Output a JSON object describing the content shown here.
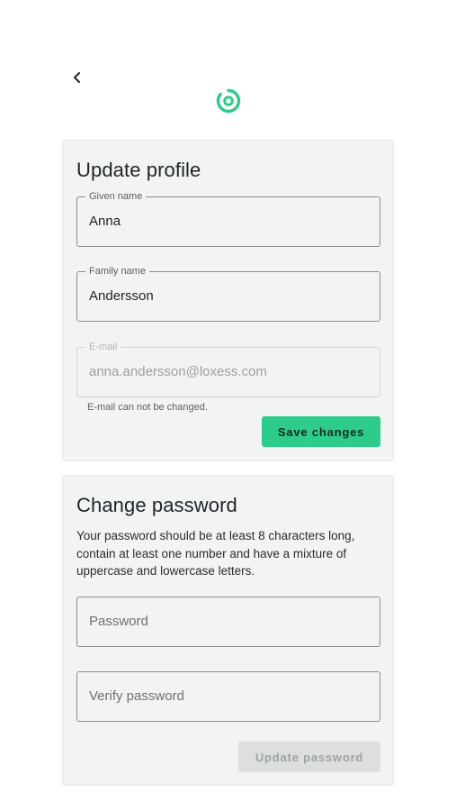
{
  "colors": {
    "accent": "#2ecc8b",
    "card_background": "#f2f4f3",
    "disabled_button": "#dcdfde"
  },
  "icons": {
    "back": "chevron-left-icon",
    "logo": "loxess-logo-icon"
  },
  "profile": {
    "title": "Update profile",
    "given_name": {
      "label": "Given name",
      "value": "Anna"
    },
    "family_name": {
      "label": "Family name",
      "value": "Andersson"
    },
    "email": {
      "label": "E-mail",
      "value": "anna.andersson@loxess.com",
      "helper": "E-mail can not be changed."
    },
    "save_label": "Save changes"
  },
  "password": {
    "title": "Change password",
    "description": "Your password should be at least 8 characters long, contain at least one number and have a mixture of uppercase and lowercase letters.",
    "password_placeholder": "Password",
    "verify_placeholder": "Verify password",
    "update_label": "Update password"
  }
}
